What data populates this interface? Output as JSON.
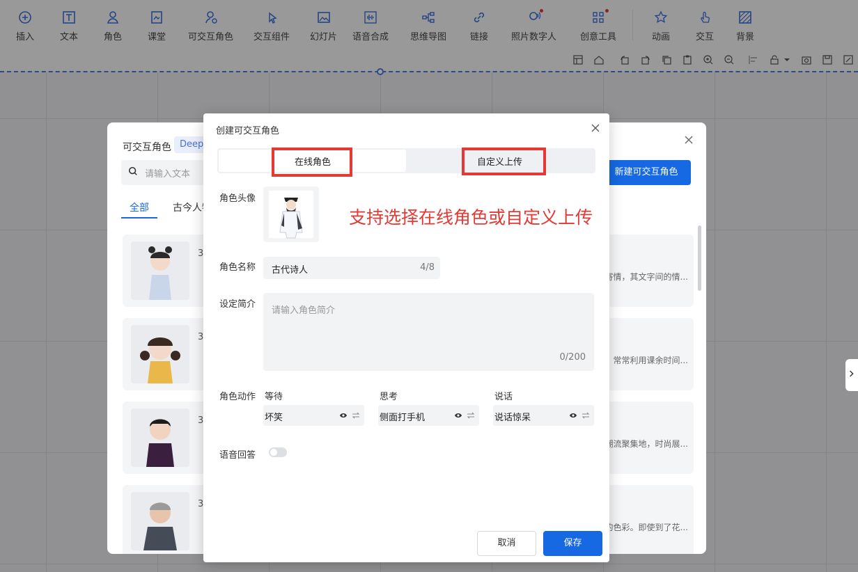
{
  "toolbar": {
    "items": [
      {
        "label": "插入",
        "icon": "plus-circle-icon"
      },
      {
        "label": "文本",
        "icon": "text-icon"
      },
      {
        "label": "角色",
        "icon": "person-icon"
      },
      {
        "label": "课堂",
        "icon": "classroom-icon"
      },
      {
        "label": "可交互角色",
        "icon": "interactive-person-icon"
      },
      {
        "label": "交互组件",
        "icon": "pointer-click-icon"
      },
      {
        "label": "幻灯片",
        "icon": "image-icon"
      },
      {
        "label": "语音合成",
        "icon": "waveform-icon"
      },
      {
        "label": "思维导图",
        "icon": "mindmap-icon"
      },
      {
        "label": "链接",
        "icon": "link-icon"
      },
      {
        "label": "照片数字人",
        "icon": "photo-avatar-icon"
      },
      {
        "label": "创意工具",
        "icon": "grid-tools-icon"
      },
      {
        "label": "动画",
        "icon": "star-icon"
      },
      {
        "label": "交互",
        "icon": "hand-icon"
      },
      {
        "label": "背景",
        "icon": "background-icon"
      }
    ]
  },
  "panel": {
    "title": "可交互角色",
    "badge": "Deep",
    "search_placeholder": "请输入文本",
    "new_button": "新建可交互角色",
    "tabs": [
      "全部",
      "古今人物"
    ],
    "cards": [
      {
        "num": "3",
        "desc": "寄情，其文字间的情..."
      },
      {
        "num": "3",
        "desc": "常常利用课余时间..."
      },
      {
        "num": "3",
        "desc": "潮流聚集地，时尚展..."
      },
      {
        "num": "3",
        "desc": "的色彩。即使到了花..."
      }
    ]
  },
  "dialog": {
    "title": "创建可交互角色",
    "tab_online": "在线角色",
    "tab_custom": "自定义上传",
    "annotation": "支持选择在线角色或自定义上传",
    "avatar_label": "角色头像",
    "name_label": "角色名称",
    "name_value": "古代诗人",
    "name_count": "4/8",
    "intro_label": "设定简介",
    "intro_placeholder": "请输入角色简介",
    "intro_count": "0/200",
    "action_label": "角色动作",
    "actions": [
      {
        "head": "等待",
        "value": "坏笑"
      },
      {
        "head": "思考",
        "value": "侧面打手机"
      },
      {
        "head": "说话",
        "value": "说话惊呆"
      }
    ],
    "voice_label": "语音回答",
    "voice_enabled": false,
    "cancel": "取消",
    "save": "保存"
  },
  "colors": {
    "accent": "#1668e3",
    "annotation_red": "#e53935"
  }
}
